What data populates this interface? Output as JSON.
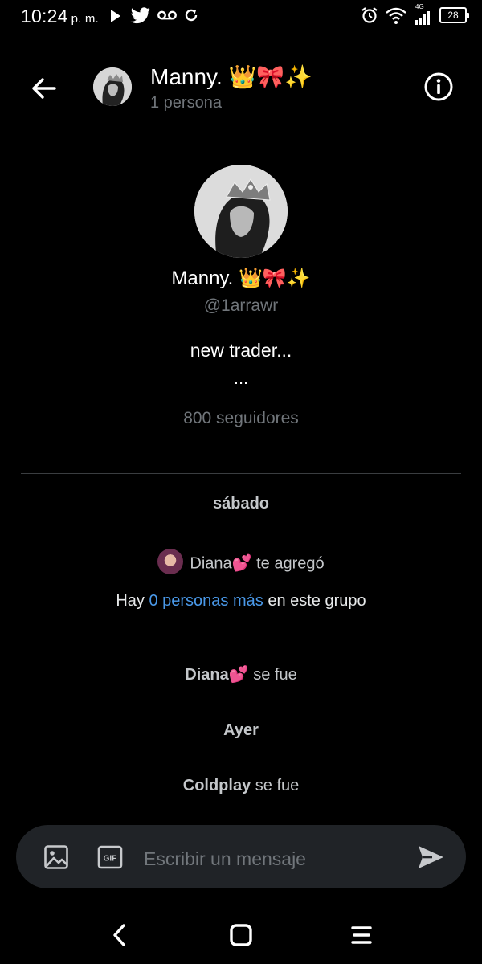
{
  "status_bar": {
    "time": "10:24",
    "ampm": "p. m.",
    "network": "4G",
    "battery": "28"
  },
  "header": {
    "title": "Manny. 👑🎀✨",
    "subtitle": "1 persona"
  },
  "profile": {
    "name": "Manny. 👑🎀✨",
    "handle": "@1arrawr",
    "bio_line1": "new trader...",
    "bio_line2": "...",
    "followers": "800 seguidores"
  },
  "events": {
    "date1": "sábado",
    "added": {
      "actor": "Diana💕",
      "action": "te agregó"
    },
    "group_note": {
      "prefix": "Hay",
      "link": "0 personas más",
      "suffix": "en este grupo"
    },
    "left1": {
      "actor": "Diana💕",
      "action": "se fue"
    },
    "date2": "Ayer",
    "left2": {
      "actor": "Coldplay",
      "action": "se fue"
    }
  },
  "composer": {
    "placeholder": "Escribir un mensaje",
    "gif_label": "GIF"
  },
  "colors": {
    "background": "#000000",
    "accent_link": "#4a99e9",
    "secondary_text": "#71767b",
    "composer_bg": "#202327"
  },
  "icons": [
    "play-icon",
    "twitter-bird-icon",
    "voicemail-icon",
    "sync-icon",
    "alarm-icon",
    "wifi-icon",
    "signal-icon",
    "battery-icon",
    "back-arrow-icon",
    "info-icon",
    "image-icon",
    "gif-icon",
    "send-icon",
    "nav-back-icon",
    "nav-home-icon",
    "nav-menu-icon"
  ]
}
